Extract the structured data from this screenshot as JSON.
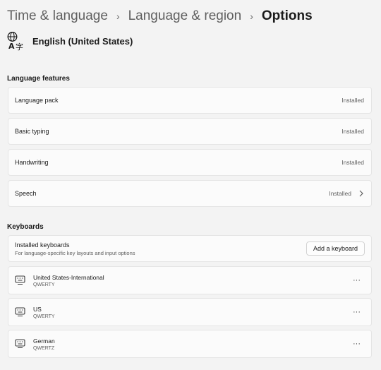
{
  "breadcrumb": {
    "items": [
      "Time & language",
      "Language & region"
    ],
    "current": "Options"
  },
  "language": {
    "icon": "language-icon",
    "name": "English (United States)"
  },
  "language_features": {
    "title": "Language features",
    "items": [
      {
        "label": "Language pack",
        "status": "Installed"
      },
      {
        "label": "Basic typing",
        "status": "Installed"
      },
      {
        "label": "Handwriting",
        "status": "Installed"
      },
      {
        "label": "Speech",
        "status": "Installed"
      }
    ]
  },
  "keyboards": {
    "title": "Keyboards",
    "installed_title": "Installed keyboards",
    "installed_desc": "For language-specific key layouts and input options",
    "add_label": "Add a keyboard",
    "items": [
      {
        "name": "United States-International",
        "layout": "QWERTY",
        "more": "···"
      },
      {
        "name": "US",
        "layout": "QWERTY",
        "more": "···"
      },
      {
        "name": "German",
        "layout": "QWERTZ",
        "more": "···"
      }
    ]
  },
  "colors": {
    "accent": "#0067c0",
    "background": "#f3f3f3",
    "card": "#fbfbfb"
  }
}
